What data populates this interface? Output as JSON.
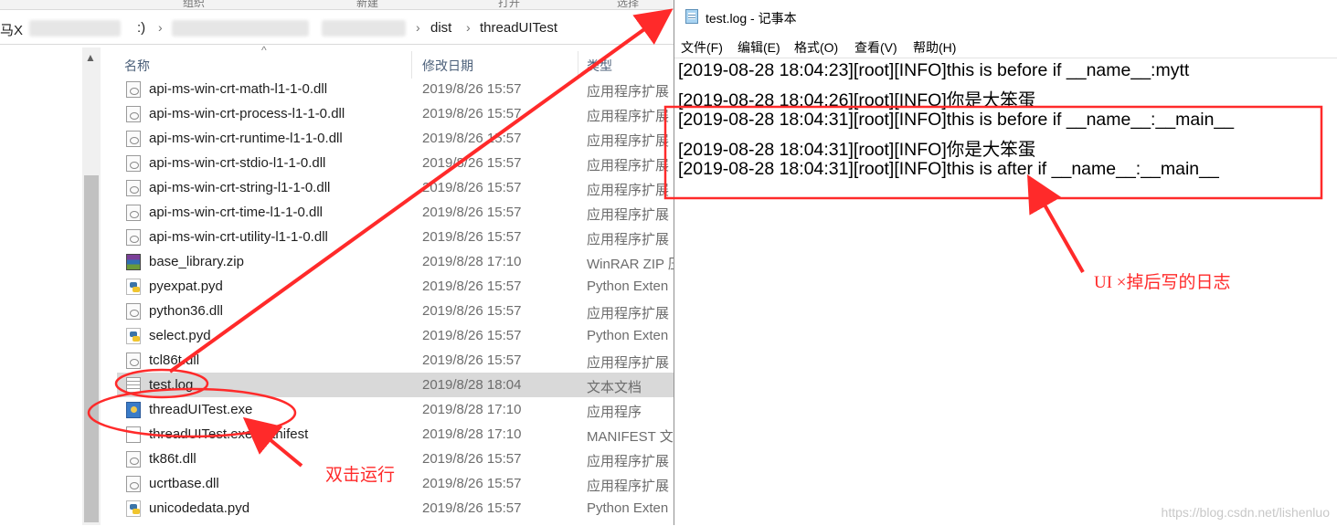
{
  "explorer": {
    "ribbon": [
      "组织",
      "新建",
      "打开",
      "选择"
    ],
    "breadcrumb": [
      "马X",
      ":)",
      "dist",
      "threadUITest"
    ],
    "columns": {
      "name": "名称",
      "date": "修改日期",
      "type": "类型"
    },
    "files": [
      {
        "name": "api-ms-win-crt-math-l1-1-0.dll",
        "date": "2019/8/26 15:57",
        "type": "应用程序扩展",
        "icon": "dll"
      },
      {
        "name": "api-ms-win-crt-process-l1-1-0.dll",
        "date": "2019/8/26 15:57",
        "type": "应用程序扩展",
        "icon": "dll"
      },
      {
        "name": "api-ms-win-crt-runtime-l1-1-0.dll",
        "date": "2019/8/26 15:57",
        "type": "应用程序扩展",
        "icon": "dll"
      },
      {
        "name": "api-ms-win-crt-stdio-l1-1-0.dll",
        "date": "2019/8/26 15:57",
        "type": "应用程序扩展",
        "icon": "dll"
      },
      {
        "name": "api-ms-win-crt-string-l1-1-0.dll",
        "date": "2019/8/26 15:57",
        "type": "应用程序扩展",
        "icon": "dll"
      },
      {
        "name": "api-ms-win-crt-time-l1-1-0.dll",
        "date": "2019/8/26 15:57",
        "type": "应用程序扩展",
        "icon": "dll"
      },
      {
        "name": "api-ms-win-crt-utility-l1-1-0.dll",
        "date": "2019/8/26 15:57",
        "type": "应用程序扩展",
        "icon": "dll"
      },
      {
        "name": "base_library.zip",
        "date": "2019/8/28 17:10",
        "type": "WinRAR ZIP 压",
        "icon": "zip"
      },
      {
        "name": "pyexpat.pyd",
        "date": "2019/8/26 15:57",
        "type": "Python Exten",
        "icon": "py"
      },
      {
        "name": "python36.dll",
        "date": "2019/8/26 15:57",
        "type": "应用程序扩展",
        "icon": "dll"
      },
      {
        "name": "select.pyd",
        "date": "2019/8/26 15:57",
        "type": "Python Exten",
        "icon": "py"
      },
      {
        "name": "tcl86t.dll",
        "date": "2019/8/26 15:57",
        "type": "应用程序扩展",
        "icon": "dll"
      },
      {
        "name": "test.log",
        "date": "2019/8/28 18:04",
        "type": "文本文档",
        "icon": "log",
        "selected": true
      },
      {
        "name": "threadUITest.exe",
        "date": "2019/8/28 17:10",
        "type": "应用程序",
        "icon": "exe"
      },
      {
        "name": "threadUITest.exe.manifest",
        "date": "2019/8/28 17:10",
        "type": "MANIFEST 文",
        "icon": "man"
      },
      {
        "name": "tk86t.dll",
        "date": "2019/8/26 15:57",
        "type": "应用程序扩展",
        "icon": "dll"
      },
      {
        "name": "ucrtbase.dll",
        "date": "2019/8/26 15:57",
        "type": "应用程序扩展",
        "icon": "dll"
      },
      {
        "name": "unicodedata.pyd",
        "date": "2019/8/26 15:57",
        "type": "Python Exten",
        "icon": "py"
      }
    ]
  },
  "notepad": {
    "title": "test.log - 记事本",
    "menu": [
      "文件(F)",
      "编辑(E)",
      "格式(O)",
      "查看(V)",
      "帮助(H)"
    ],
    "lines": [
      "[2019-08-28 18:04:23][root][INFO]this is before if __name__:mytt",
      "[2019-08-28 18:04:26][root][INFO]你是大笨蛋",
      "[2019-08-28 18:04:31][root][INFO]this is before if __name__:__main__",
      "[2019-08-28 18:04:31][root][INFO]你是大笨蛋",
      "[2019-08-28 18:04:31][root][INFO]this is after if __name__:__main__"
    ],
    "watermark": "https://blog.csdn.net/lishenluo"
  },
  "annotations": {
    "double_click": "双击运行",
    "ui_closed": "UI ×掉后写的日志",
    "color": "#ff2a2a"
  }
}
